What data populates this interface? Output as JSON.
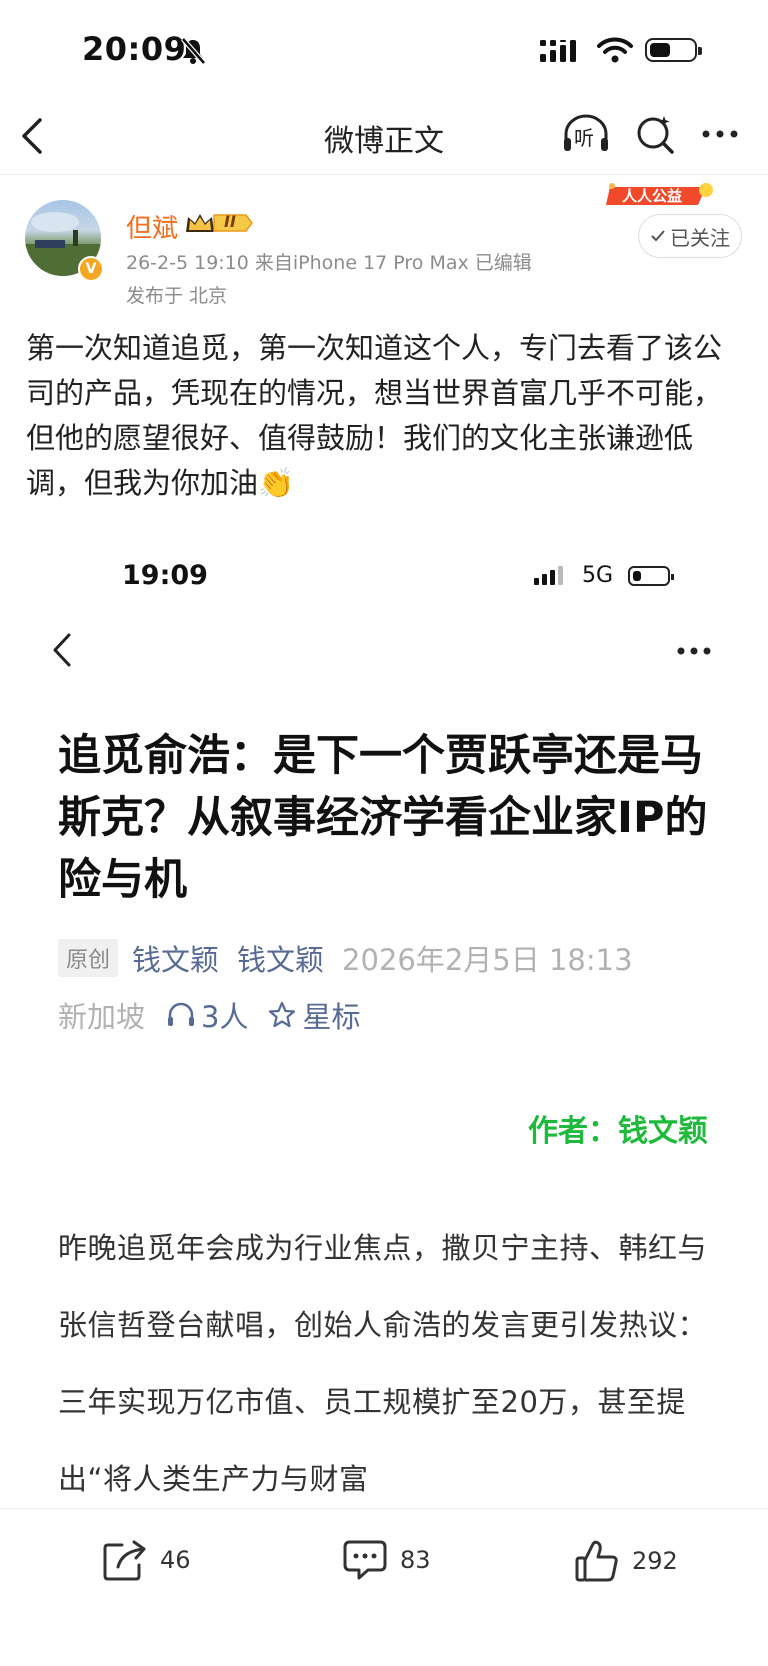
{
  "status_bar": {
    "time": "20:09"
  },
  "nav": {
    "title": "微博正文",
    "listen_label": "听"
  },
  "post": {
    "author": "但斌",
    "vip_level": "II",
    "charity_label": "人人公益",
    "follow_label": "已关注",
    "meta": "26-2-5 19:10  来自iPhone 17 Pro Max  已编辑",
    "location": "发布于 北京",
    "text": "第一次知道追觅，第一次知道这个人，专门去看了该公司的产品，凭现在的情况，想当世界首富几乎不可能，但他的愿望很好、值得鼓励！我们的文化主张谦逊低调，但我为你加油👏"
  },
  "embedded": {
    "time": "19:09",
    "network": "5G",
    "article": {
      "title": "追觅俞浩：是下一个贾跃亭还是马斯克？从叙事经济学看企业家IP的险与机",
      "tag": "原创",
      "author_link1": "钱文颖",
      "author_link2": "钱文颖",
      "date": "2026年2月5日 18:13",
      "location": "新加坡",
      "listeners": "3人",
      "star_label": "星标",
      "byline": "作者：钱文颖",
      "body": "昨晚追觅年会成为行业焦点，撒贝宁主持、韩红与张信哲登台献唱，创始人俞浩的发言更引发热议：三年实现万亿市值、员工规模扩至20万，甚至提出“将人类生产力与财富"
    }
  },
  "actions": {
    "repost_count": "46",
    "comment_count": "83",
    "like_count": "292"
  },
  "colors": {
    "author_orange": "#f36f20",
    "link_blue": "#576b95",
    "byline_green": "#1fb93b"
  }
}
